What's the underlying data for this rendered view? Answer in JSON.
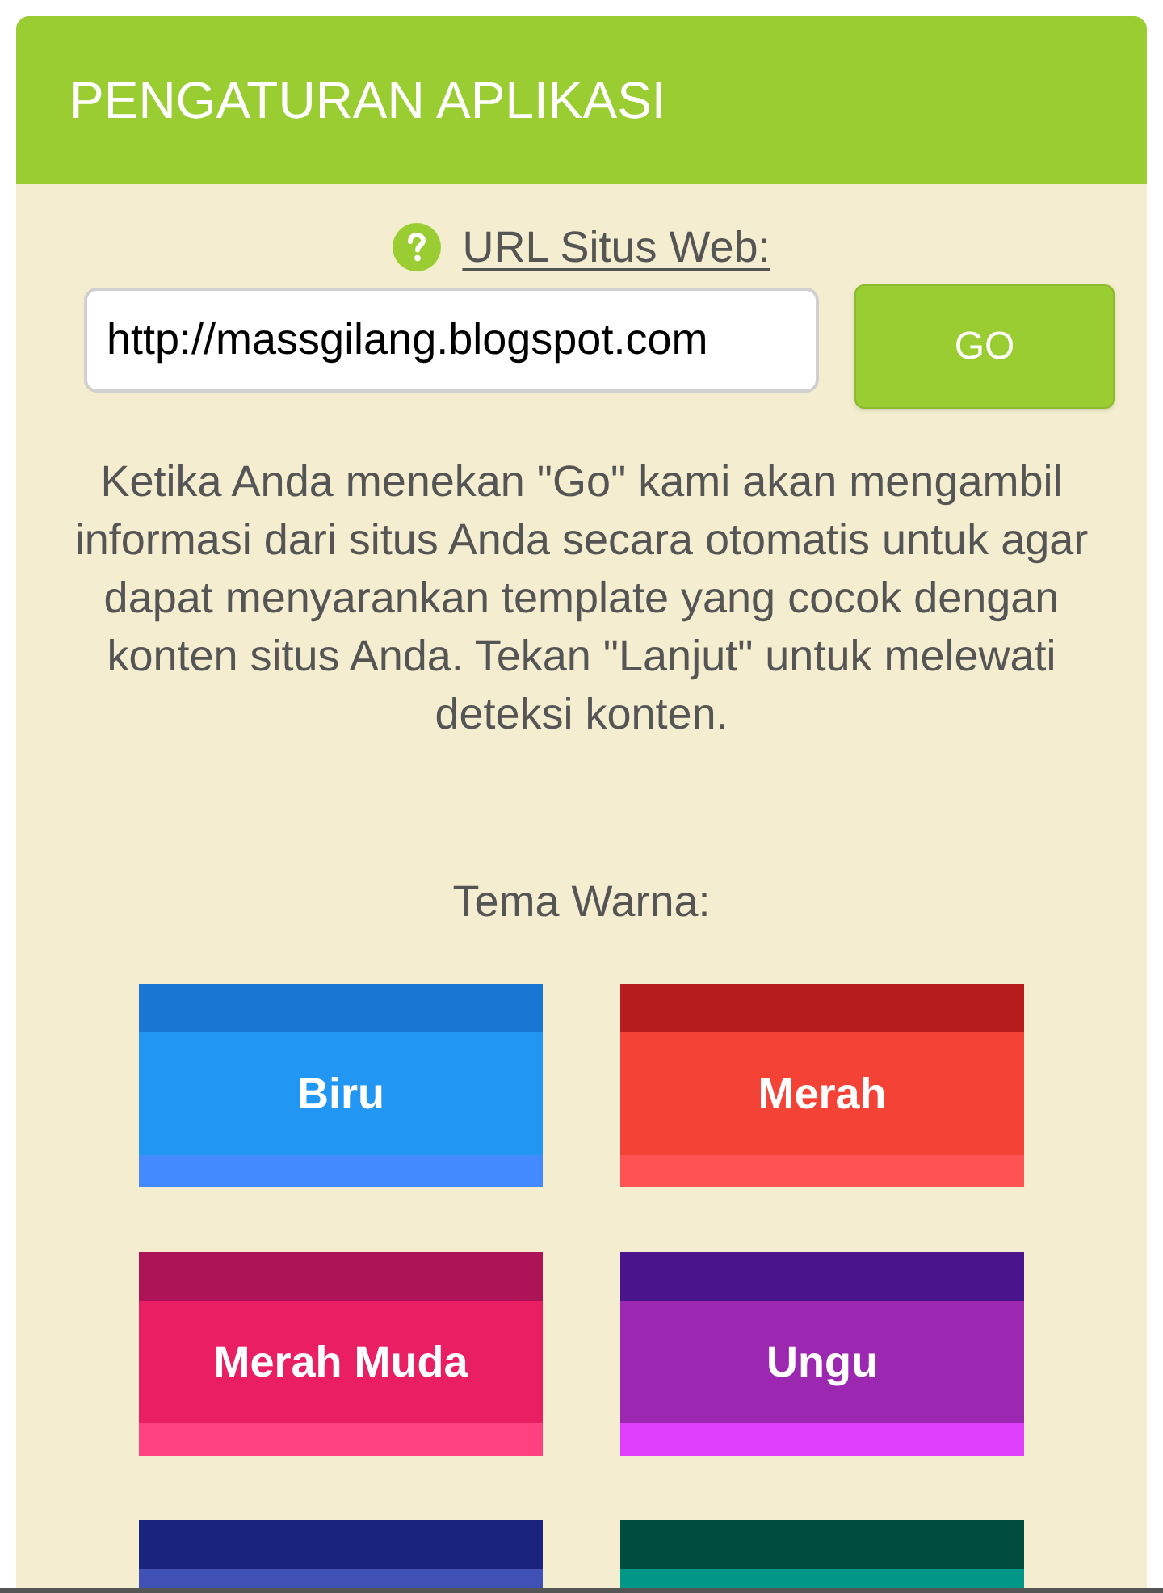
{
  "header": {
    "title": "PENGATURAN APLIKASI"
  },
  "url_field": {
    "label": "URL Situs Web:",
    "value": "http://massgilang.blogspot.com",
    "button": "GO"
  },
  "description": "Ketika Anda menekan \"Go\" kami akan mengambil informasi dari situs Anda secara otomatis untuk agar dapat menyarankan template yang cocok dengan konten situs Anda. Tekan \"Lanjut\" untuk melewati deteksi konten.",
  "theme_section": {
    "title": "Tema Warna:",
    "themes": [
      {
        "label": "Biru",
        "color": "#2196f3",
        "stripes": [
          {
            "kind": "top",
            "color": "#1976d2"
          },
          {
            "kind": "bottom",
            "color": "#448aff"
          }
        ]
      },
      {
        "label": "Merah",
        "color": "#f44336",
        "stripes": [
          {
            "kind": "top",
            "color": "#b71c1c"
          },
          {
            "kind": "bottom",
            "color": "#ff5252"
          }
        ]
      },
      {
        "label": "Merah Muda",
        "color": "#e91e63",
        "stripes": [
          {
            "kind": "top",
            "color": "#ad1457"
          },
          {
            "kind": "bottom",
            "color": "#ff4081"
          }
        ]
      },
      {
        "label": "Ungu",
        "color": "#9c27b0",
        "stripes": [
          {
            "kind": "top",
            "color": "#4a148c"
          },
          {
            "kind": "bottom",
            "color": "#e040fb"
          }
        ]
      },
      {
        "color": "#3f51b5",
        "stripes": [
          {
            "kind": "top",
            "color": "#1a237e"
          }
        ]
      },
      {
        "color": "#009688",
        "stripes": [
          {
            "kind": "top",
            "color": "#004d40"
          }
        ]
      }
    ]
  }
}
